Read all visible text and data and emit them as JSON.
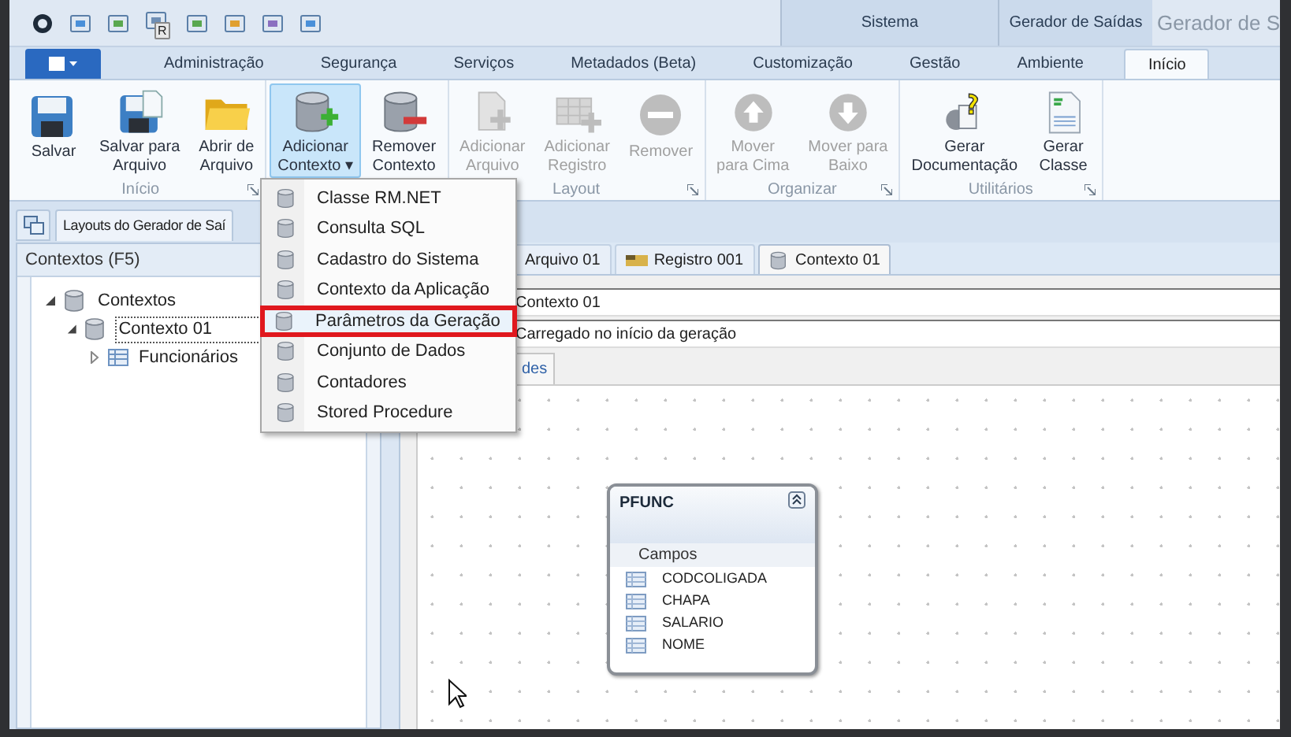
{
  "quick_access": {
    "badge": "R"
  },
  "context_groups": [
    {
      "label": "Sistema"
    },
    {
      "label": "Gerador de Saídas"
    }
  ],
  "window": {
    "title": "Gerador de S"
  },
  "tabs": [
    {
      "label": "Administração",
      "selected": false
    },
    {
      "label": "Segurança",
      "selected": false
    },
    {
      "label": "Serviços",
      "selected": false
    },
    {
      "label": "Metadados (Beta)",
      "selected": false
    },
    {
      "label": "Customização",
      "selected": false
    },
    {
      "label": "Gestão",
      "selected": false
    },
    {
      "label": "Ambiente",
      "selected": false
    },
    {
      "label": "Início",
      "selected": true
    }
  ],
  "ribbon": {
    "groups": [
      {
        "label": "Início",
        "buttons": [
          {
            "label": "Salvar",
            "kind": "save",
            "disabled": false,
            "active": false
          },
          {
            "label": "Salvar para\nArquivo",
            "kind": "save_as",
            "disabled": false,
            "active": false
          },
          {
            "label": "Abrir de\nArquivo",
            "kind": "folder",
            "disabled": false,
            "active": false
          }
        ]
      },
      {
        "buttons": [
          {
            "label": "Adicionar\nContexto",
            "kind": "db_add",
            "disabled": false,
            "active": true,
            "caret": "▾"
          },
          {
            "label": "Remover\nContexto",
            "kind": "db_remove",
            "disabled": false,
            "active": false
          }
        ]
      },
      {
        "label": "Layout",
        "buttons": [
          {
            "label": "Adicionar\nArquivo",
            "kind": "page_add",
            "disabled": true,
            "active": false
          },
          {
            "label": "Adicionar\nRegistro",
            "kind": "grid_add",
            "disabled": true,
            "active": false
          },
          {
            "label": "Remover",
            "kind": "minus",
            "disabled": true,
            "active": false
          }
        ]
      },
      {
        "label": "Organizar",
        "buttons": [
          {
            "label": "Mover\npara Cima",
            "kind": "up",
            "disabled": true,
            "active": false
          },
          {
            "label": "Mover para\nBaixo",
            "kind": "down",
            "disabled": true,
            "active": false
          }
        ]
      },
      {
        "label": "Utilitários",
        "buttons": [
          {
            "label": "Gerar\nDocumentação",
            "kind": "doc_help",
            "disabled": false,
            "active": false
          },
          {
            "label": "Gerar\nClasse",
            "kind": "code_file",
            "disabled": false,
            "active": false
          }
        ]
      }
    ]
  },
  "document_tabs": [
    {
      "label": "Layouts do Gerador de Saí"
    }
  ],
  "left_panel": {
    "title": "Contextos (F5)",
    "tree": [
      {
        "label": "Contextos",
        "kind": "database",
        "expanded": true,
        "focused": false,
        "children": [
          {
            "label": "Contexto 01",
            "kind": "database",
            "expanded": true,
            "focused": true,
            "children": [
              {
                "label": "Funcionários",
                "kind": "table",
                "expanded": false,
                "focused": false
              }
            ]
          }
        ]
      }
    ]
  },
  "editor_tabs": [
    {
      "label": "Arquivo 01",
      "kind": "plain",
      "selected": false
    },
    {
      "label": "Registro 001",
      "kind": "record",
      "selected": false
    },
    {
      "label": "Contexto 01",
      "kind": "database",
      "selected": true
    }
  ],
  "properties": [
    {
      "value": "Contexto 01"
    },
    {
      "value": "Carregado no início da geração"
    }
  ],
  "sub_tab": {
    "label": "des"
  },
  "entity": {
    "title": "PFUNC",
    "section": "Campos",
    "fields": [
      "CODCOLIGADA",
      "CHAPA",
      "SALARIO",
      "NOME"
    ]
  },
  "menu": {
    "items": [
      {
        "label": "Classe RM.NET",
        "selected": false
      },
      {
        "label": "Consulta SQL",
        "selected": false
      },
      {
        "label": "Cadastro do Sistema",
        "selected": false
      },
      {
        "label": "Contexto da Aplicação",
        "selected": false
      },
      {
        "label": "Parâmetros da Geração",
        "selected": true
      },
      {
        "label": "Conjunto de Dados",
        "selected": false
      },
      {
        "label": "Contadores",
        "selected": false
      },
      {
        "label": "Stored Procedure",
        "selected": false
      }
    ]
  }
}
